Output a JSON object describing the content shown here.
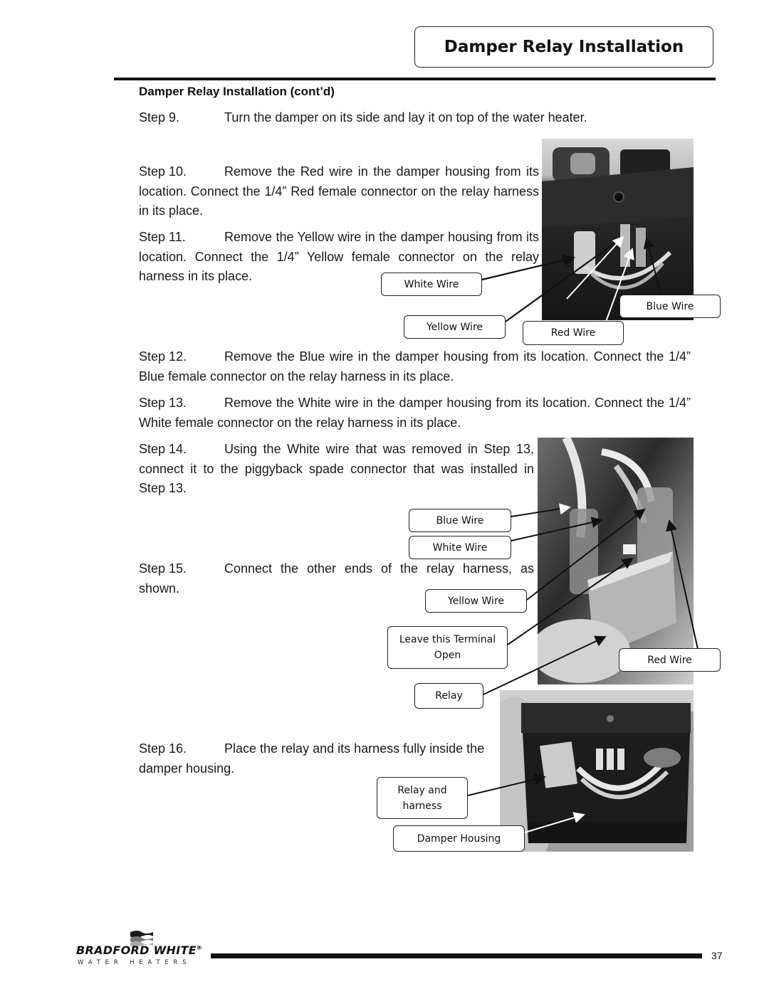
{
  "header": {
    "title": "Damper Relay Installation"
  },
  "section_heading": "Damper Relay Installation  (cont’d)",
  "steps": [
    {
      "num": "Step 9.",
      "text": "Turn the damper on its side and lay it on top of the water heater."
    },
    {
      "num": "Step 10.",
      "text": "Remove the Red wire in the damper housing from its location.  Connect the 1/4” Red female connector on the relay harness in its place."
    },
    {
      "num": "Step 11.",
      "text": "Remove the Yellow wire in the damper housing from its location.  Connect the 1/4” Yellow female connector on the relay harness in its place."
    },
    {
      "num": "Step 12.",
      "text": "Remove the Blue wire in the damper housing from its location.  Connect the 1/4” Blue female connector on the relay harness in its place."
    },
    {
      "num": "Step 13.",
      "text": "Remove the White wire in the damper housing from its location.  Connect the 1/4” White female connector on the relay harness in its place."
    },
    {
      "num": "Step 14.",
      "text": "Using the White wire that was removed in Step 13, connect it to the piggyback spade connector that was installed in Step 13."
    },
    {
      "num": "Step 15.",
      "text": "Connect the other ends of the relay harness, as shown."
    },
    {
      "num": "Step 16.",
      "text": "Place the relay and its harness fully inside the damper housing."
    }
  ],
  "figures": [
    {
      "name": "damper-housing-wires-photo",
      "callouts": [
        "White Wire",
        "Yellow Wire",
        "Red Wire",
        "Blue Wire"
      ]
    },
    {
      "name": "relay-harness-photo",
      "callouts": [
        "Blue Wire",
        "White Wire",
        "Yellow Wire",
        "Leave this Terminal Open",
        "Red Wire",
        "Relay"
      ]
    },
    {
      "name": "relay-in-housing-photo",
      "callouts": [
        "Relay and harness",
        "Damper Housing"
      ]
    }
  ],
  "footer": {
    "brand": "BRADFORD WHITE",
    "registered": "®",
    "tagline": "WATER HEATERS",
    "page_number": "37"
  }
}
